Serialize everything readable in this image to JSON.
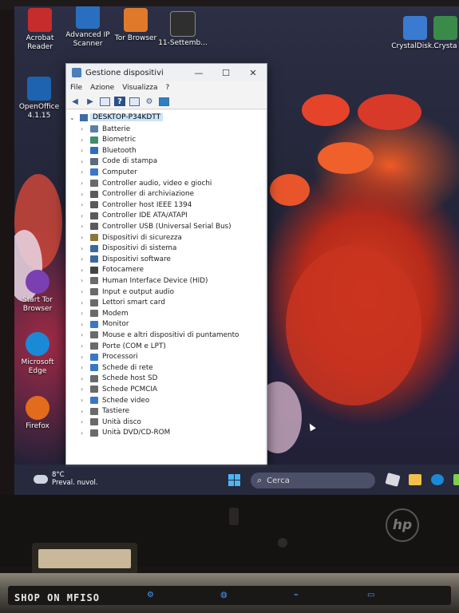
{
  "desktop": {
    "icons": [
      {
        "label": "Acrobat\nReader",
        "color": "#c62c2c"
      },
      {
        "label": "Advanced IP\nScanner",
        "color": "#2a6fbf"
      },
      {
        "label": "Tor Browser",
        "color": "#7a3fb0"
      },
      {
        "label": "11-Settemb...",
        "color": "#2f2f2f"
      },
      {
        "label": "CrystalDisk...",
        "color": "#3a7ad0"
      },
      {
        "label": "Crysta",
        "color": "#3a8a4a"
      },
      {
        "label": "OpenOffice\n4.1.15",
        "color": "#1e63b0"
      },
      {
        "label": "Start Tor\nBrowser",
        "color": "#7a3fb0"
      },
      {
        "label": "Microsoft\nEdge",
        "color": "#1b8ad6"
      },
      {
        "label": "Firefox",
        "color": "#e36b1c"
      }
    ]
  },
  "window": {
    "title": "Gestione dispositivi",
    "controls": {
      "minimize": "—",
      "maximize": "☐",
      "close": "✕"
    },
    "menu": [
      "File",
      "Azione",
      "Visualizza",
      "?"
    ],
    "toolbar_icons": [
      "back-arrow-icon",
      "forward-arrow-icon",
      "show-hide-console-tree-icon",
      "help-icon",
      "properties-icon",
      "scan-hardware-icon",
      "monitor-icon"
    ],
    "root": "DESKTOP-P34KDTT",
    "devices": [
      "Batterie",
      "Biometric",
      "Bluetooth",
      "Code di stampa",
      "Computer",
      "Controller audio, video e giochi",
      "Controller di archiviazione",
      "Controller host IEEE 1394",
      "Controller IDE ATA/ATAPI",
      "Controller USB (Universal Serial Bus)",
      "Dispositivi di sicurezza",
      "Dispositivi di sistema",
      "Dispositivi software",
      "Fotocamere",
      "Human Interface Device (HID)",
      "Input e output audio",
      "Lettori smart card",
      "Modem",
      "Monitor",
      "Mouse e altri dispositivi di puntamento",
      "Porte (COM e LPT)",
      "Processori",
      "Schede di rete",
      "Schede host SD",
      "Schede PCMCIA",
      "Schede video",
      "Tastiere",
      "Unità disco",
      "Unità DVD/CD-ROM"
    ]
  },
  "taskbar": {
    "weather_temp": "8°C",
    "weather_desc": "Preval. nuvol.",
    "search_placeholder": "Cerca"
  },
  "laptop": {
    "brand": "hp",
    "watermark": "SHOP ON MFISO"
  }
}
